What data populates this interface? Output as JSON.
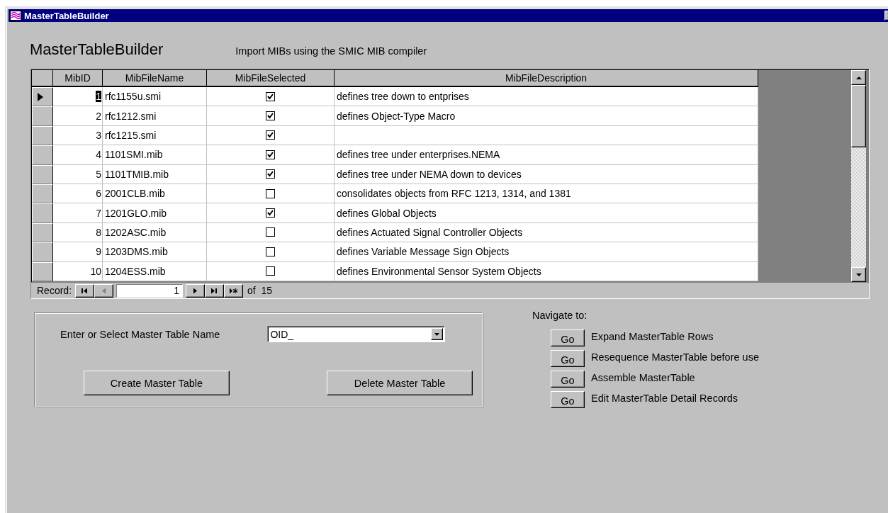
{
  "window": {
    "title": "MasterTableBuilder"
  },
  "form": {
    "heading": "MasterTableBuilder",
    "subtitle": "Import MIBs using the SMIC MIB compiler"
  },
  "grid": {
    "columns": [
      "MibID",
      "MibFileName",
      "MibFileSelected",
      "MibFileDescription"
    ],
    "rows": [
      {
        "current": true,
        "id": "1",
        "file": "rfc1155u.smi",
        "selected_file": true,
        "description": "defines tree down to entprises"
      },
      {
        "current": false,
        "id": "2",
        "file": "rfc1212.smi",
        "selected_file": true,
        "description": "defines Object-Type Macro"
      },
      {
        "current": false,
        "id": "3",
        "file": "rfc1215.smi",
        "selected_file": true
      },
      {
        "current": false,
        "id": "4",
        "file": "1101SMI.mib",
        "selected_file": true,
        "description": "defines tree under enterprises.NEMA"
      },
      {
        "current": false,
        "id": "5",
        "file": "1101TMIB.mib",
        "selected_file": true,
        "description": "defines tree under NEMA down to devices"
      },
      {
        "current": false,
        "id": "6",
        "file": "2001CLB.mib",
        "selected_file": false,
        "description": "consolidates objects from RFC 1213, 1314, and 1381"
      },
      {
        "current": false,
        "id": "7",
        "file": "1201GLO.mib",
        "selected_file": true,
        "description": "defines Global Objects"
      },
      {
        "current": false,
        "id": "8",
        "file": "1202ASC.mib",
        "selected_file": false,
        "description": "defines Actuated Signal Controller Objects"
      },
      {
        "current": false,
        "id": "9",
        "file": "1203DMS.mib",
        "selected_file": false,
        "description": "defines Variable Message Sign Objects"
      },
      {
        "current": false,
        "id": "10",
        "file": "1204ESS.mib",
        "selected_file": false,
        "description": "defines Environmental Sensor System Objects"
      }
    ],
    "navigator": {
      "label": "Record:",
      "current": "1",
      "total": "of  15"
    }
  },
  "master_table": {
    "label": "Enter or Select Master Table Name",
    "value": "OID_",
    "buttons": [
      "Create Master Table",
      "Delete Master Table"
    ]
  },
  "navigate": {
    "label": "Navigate to:",
    "items": [
      {
        "button": "Go",
        "label": "Expand MasterTable Rows"
      },
      {
        "button": "Go",
        "label": "Resequence MasterTable before use"
      },
      {
        "button": "Go",
        "label": "Assemble MasterTable"
      },
      {
        "button": "Go",
        "label": "Edit MasterTable Detail Records"
      }
    ]
  }
}
